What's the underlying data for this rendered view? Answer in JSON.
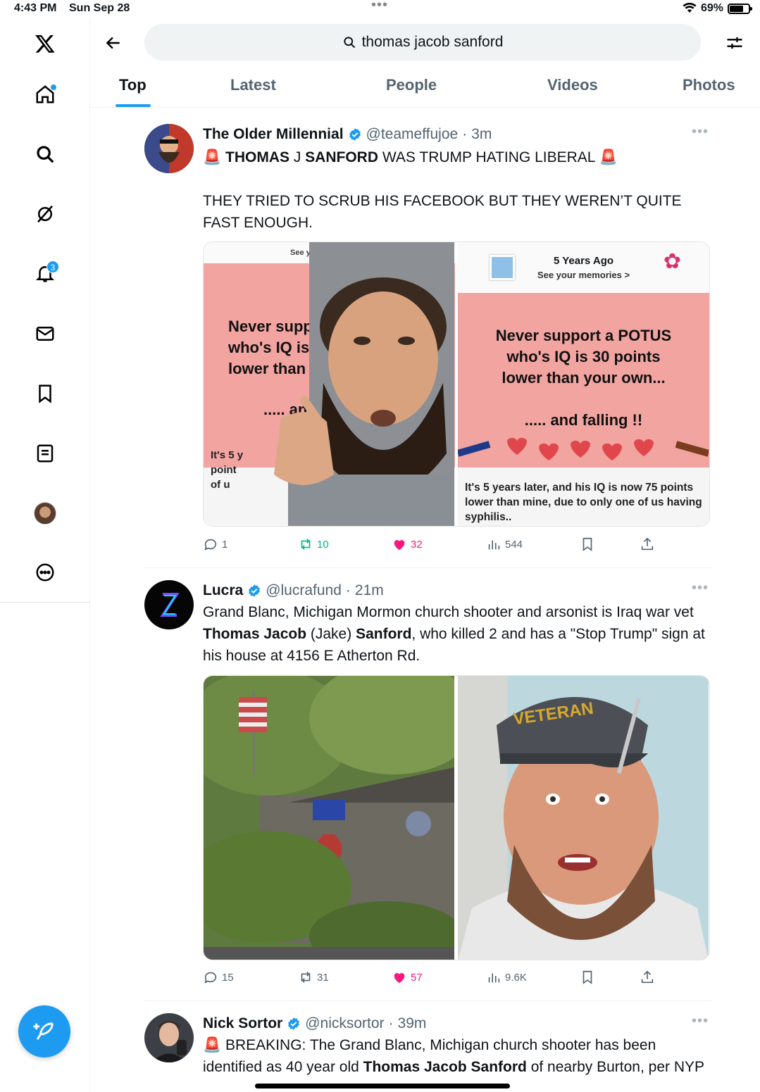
{
  "status_bar": {
    "time": "4:43 PM",
    "date": "Sun Sep 28",
    "battery": "69%"
  },
  "nav": {
    "notifications_badge": "3"
  },
  "search": {
    "query": "thomas jacob sanford"
  },
  "tabs": [
    "Top",
    "Latest",
    "People",
    "Videos",
    "Photos"
  ],
  "tweets": [
    {
      "name": "The Older Millennial",
      "handle": "@teameffujoe",
      "time": "3m",
      "headline_bold1": "THOMAS",
      "headline_j": " J ",
      "headline_bold2": "SANFORD",
      "headline_rest": " WAS TRUMP HATING LIBERAL",
      "body": "THEY TRIED TO SCRUB HIS FACEBOOK BUT THEY WEREN’T QUITE FAST ENOUGH.",
      "replies": "1",
      "reposts": "10",
      "likes": "32",
      "views": "544",
      "meme_left": {
        "headline": "Never supp\nwho's IQ is\nlower than",
        "falling": "..... and f",
        "caption": "It's 5 y\npoint\nof u",
        "top": "See your memories >"
      },
      "meme_right": {
        "years_ago": "5 Years Ago",
        "see_memories": "See your memories >",
        "headline": "Never support a POTUS\nwho's IQ is 30 points\nlower than your own...",
        "falling": "..... and falling !!",
        "caption": "It's 5 years later, and his IQ is now 75 points lower than mine, due to only one of us having syphilis.."
      }
    },
    {
      "name": "Lucra",
      "handle": "@lucrafund",
      "time": "21m",
      "body_parts": [
        "Grand Blanc, Michigan Mormon church shooter and arsonist is Iraq war vet ",
        "Thomas Jacob",
        " (Jake) ",
        "Sanford",
        ", who killed 2 and has a \"Stop Trump\" sign at his house at 4156 E Atherton Rd."
      ],
      "hat_text": "VETERAN",
      "replies": "15",
      "reposts": "31",
      "likes": "57",
      "views": "9.6K"
    },
    {
      "name": "Nick Sortor",
      "handle": "@nicksortor",
      "time": "39m",
      "body_parts": [
        "BREAKING: The Grand Blanc, Michigan church shooter has been identified as 40 year old ",
        "Thomas Jacob Sanford",
        " of nearby Burton, per NYP"
      ]
    }
  ],
  "colors": {
    "accent": "#1d9bf0",
    "repost": "#00ba7c",
    "like": "#f91880",
    "secondary_text": "#536471"
  }
}
